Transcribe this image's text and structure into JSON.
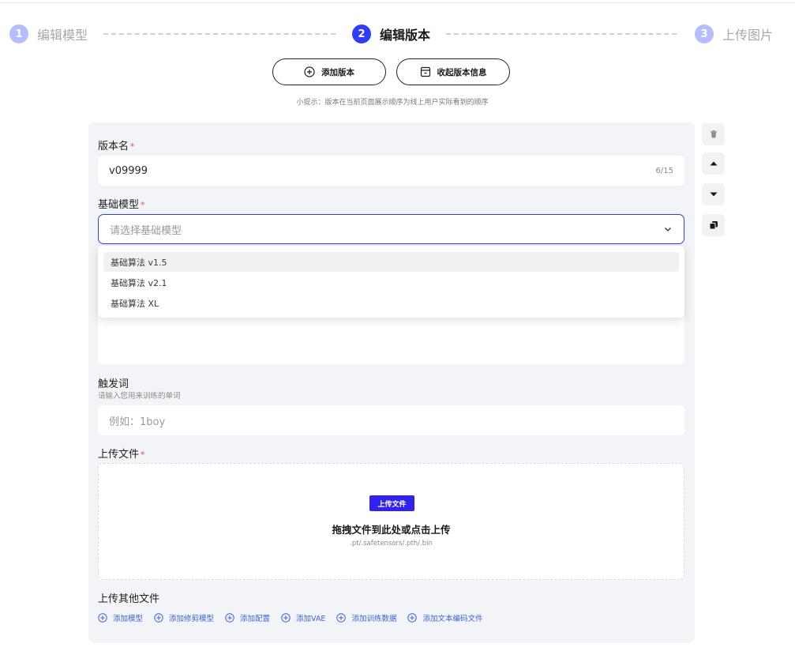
{
  "steps": [
    {
      "num": "1",
      "label": "编辑模型"
    },
    {
      "num": "2",
      "label": "编辑版本"
    },
    {
      "num": "3",
      "label": "上传图片"
    }
  ],
  "actions": {
    "add_version": "添加版本",
    "collapse_info": "收起版本信息",
    "tip": "小提示：版本在当前页面展示顺序为线上用户实际看到的顺序"
  },
  "form": {
    "version_name": {
      "label": "版本名",
      "required": "*",
      "value": "v09999",
      "count": "6/15"
    },
    "base_model": {
      "label": "基础模型",
      "required": "*",
      "placeholder": "请选择基础模型",
      "options": [
        "基础算法 v1.5",
        "基础算法 v2.1",
        "基础算法 XL"
      ],
      "highlighted_index": 0
    },
    "trigger_words": {
      "label": "触发词",
      "sub": "请输入您用来训练的单词",
      "placeholder": "例如：1boy"
    },
    "upload": {
      "label": "上传文件",
      "required": "*",
      "button": "上传文件",
      "title": "拖拽文件到此处或点击上传",
      "hint": ".pt/.safetensors/.pth/.bin"
    },
    "other_files": {
      "label": "上传其他文件",
      "links": [
        "添加模型",
        "添加修剪模型",
        "添加配置",
        "添加VAE",
        "添加训练数据",
        "添加文本编码文件"
      ]
    }
  },
  "tools": [
    "trash-icon",
    "move-up-icon",
    "move-down-icon",
    "copy-icon"
  ],
  "colors": {
    "accent": "#2e3dfb",
    "step_inactive": "#b5bdfd",
    "link": "#3a63d8",
    "required": "#e34d59",
    "upload_button": "#3023f0"
  }
}
